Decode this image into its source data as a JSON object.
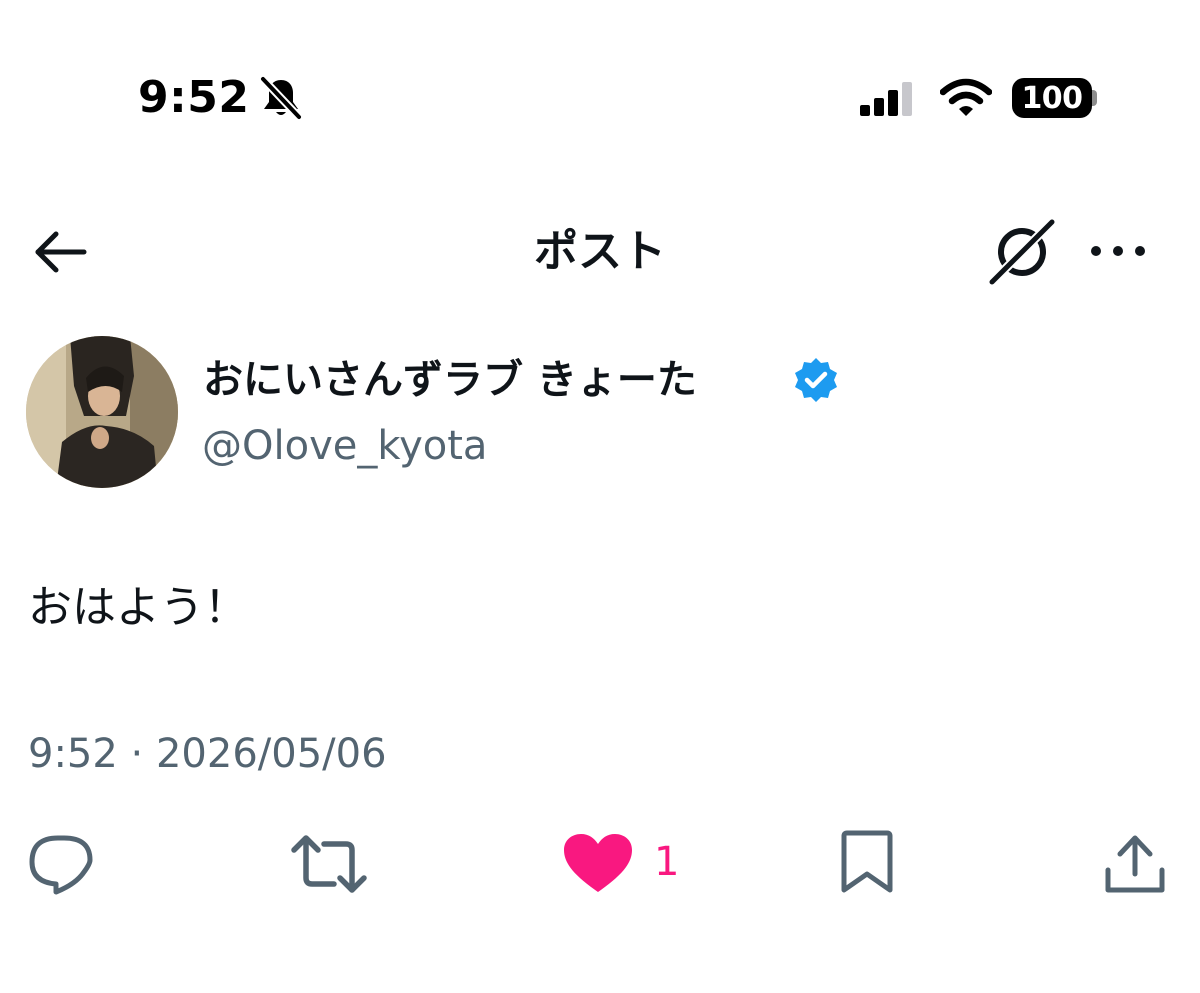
{
  "status_bar": {
    "time": "9:52",
    "battery": "100",
    "icons": [
      "bell-slash-icon",
      "cellular-signal-icon",
      "wifi-icon",
      "battery-icon"
    ]
  },
  "nav": {
    "title": "ポスト",
    "icons": [
      "back-arrow-icon",
      "grok-icon",
      "more-icon"
    ]
  },
  "tweet": {
    "display_name": "おにいさんずラブ きょーた",
    "handle": "@Olove_kyota",
    "text": "おはよう！",
    "timestamp": "9:52 · 2026/05/06",
    "verified": true
  },
  "actions": {
    "like_count": "1",
    "liked": true,
    "icons": [
      "reply-icon",
      "retweet-icon",
      "heart-icon",
      "bookmark-icon",
      "share-icon"
    ]
  },
  "colors": {
    "text_primary": "#0f1419",
    "text_secondary": "#536471",
    "like": "#f91880",
    "verified": "#1d9bf0"
  }
}
